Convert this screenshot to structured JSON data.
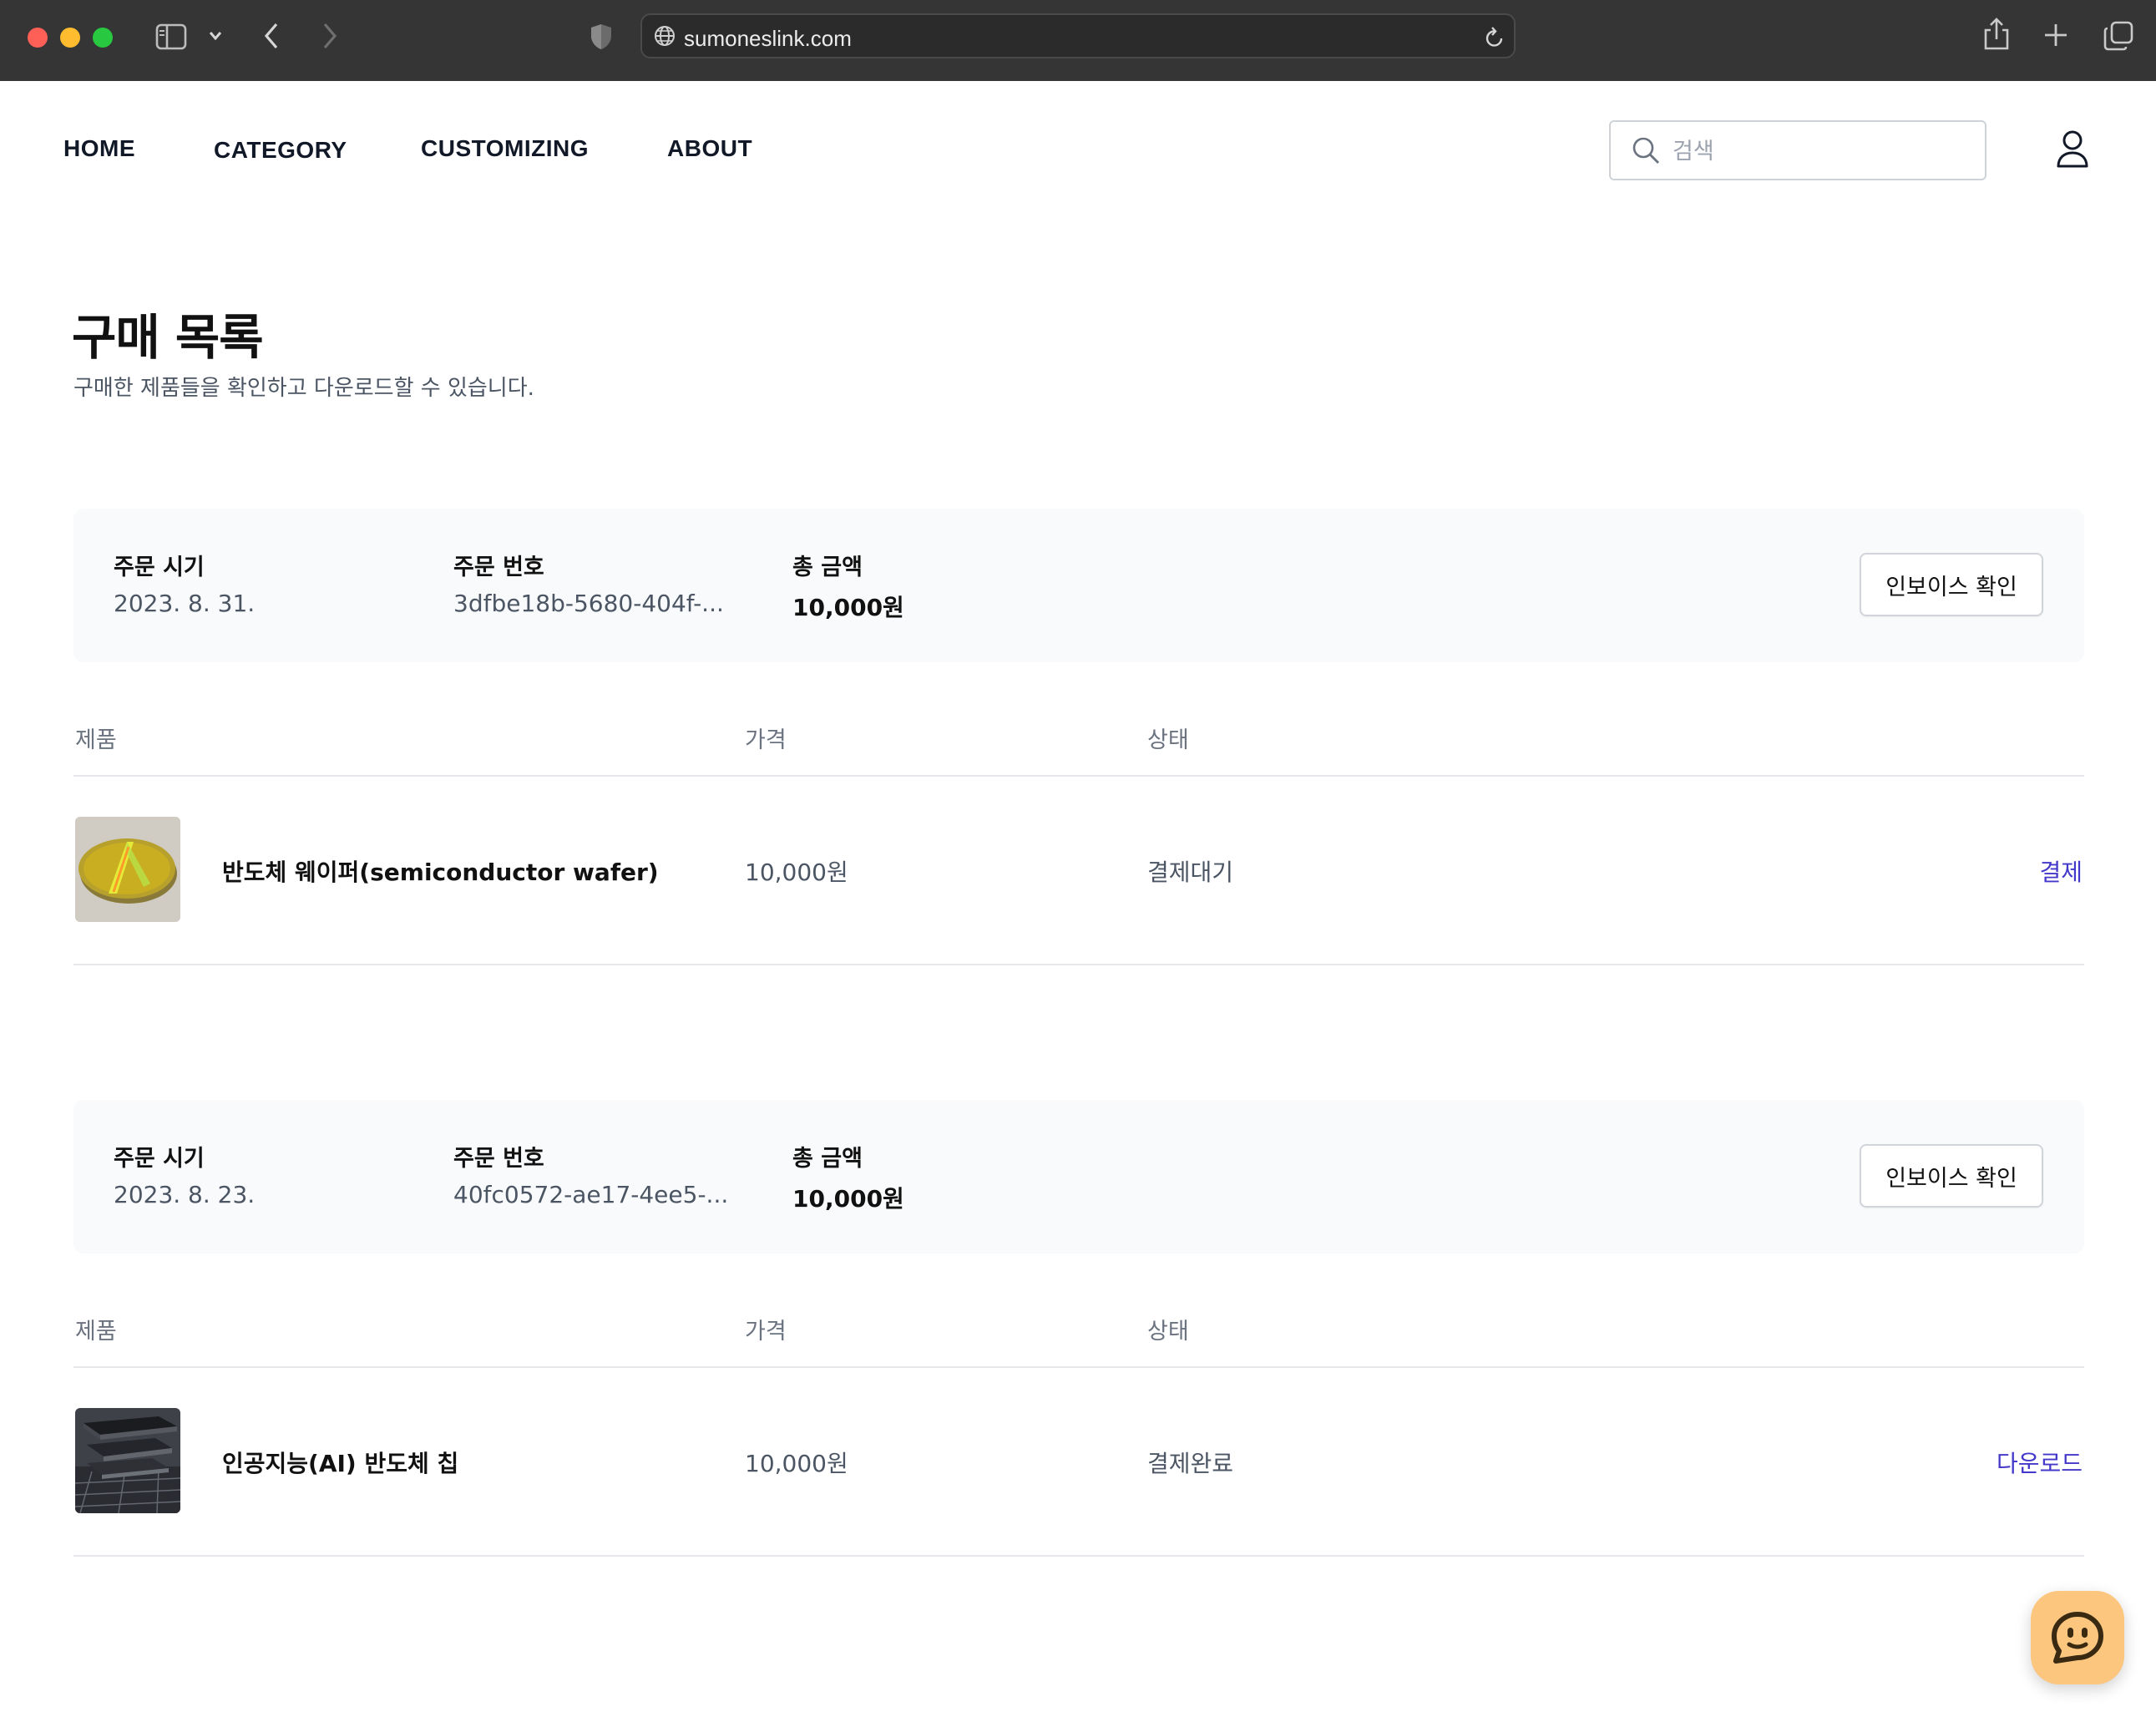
{
  "browser": {
    "url": "sumoneslink.com"
  },
  "nav": {
    "items": [
      {
        "label": "HOME"
      },
      {
        "label": "CATEGORY"
      },
      {
        "label": "CUSTOMIZING"
      },
      {
        "label": "ABOUT"
      }
    ],
    "search_placeholder": "검색"
  },
  "page": {
    "title": "구매 목록",
    "subtitle": "구매한 제품들을 확인하고 다운로드할 수 있습니다."
  },
  "labels": {
    "order_date": "주문 시기",
    "order_number": "주문 번호",
    "total_amount": "총 금액",
    "invoice_button": "인보이스 확인",
    "col_product": "제품",
    "col_price": "가격",
    "col_status": "상태"
  },
  "orders": [
    {
      "date": "2023. 8. 31.",
      "number": "3dfbe18b-5680-404f-...",
      "total": "10,000원",
      "product": {
        "name": "반도체 웨이퍼(semiconductor wafer)",
        "price": "10,000원",
        "status": "결제대기",
        "action": "결제"
      }
    },
    {
      "date": "2023. 8. 23.",
      "number": "40fc0572-ae17-4ee5-...",
      "total": "10,000원",
      "product": {
        "name": "인공지능(AI) 반도체 칩",
        "price": "10,000원",
        "status": "결제완료",
        "action": "다운로드"
      }
    }
  ],
  "icons": {
    "sidebar": "sidebar-icon",
    "back": "chevron-left-icon",
    "forward": "chevron-right-icon",
    "privacy": "shield-icon",
    "globe": "globe-icon",
    "reload": "reload-icon",
    "share": "share-icon",
    "new_tab": "plus-icon",
    "tabs": "tabs-icon",
    "search": "search-icon",
    "user": "user-icon",
    "chat": "chat-icon"
  },
  "colors": {
    "chrome_bg": "#353535",
    "accent_link": "#4338ca",
    "summary_bg": "#f9fafb",
    "chat_fab": "#fcc67f"
  }
}
